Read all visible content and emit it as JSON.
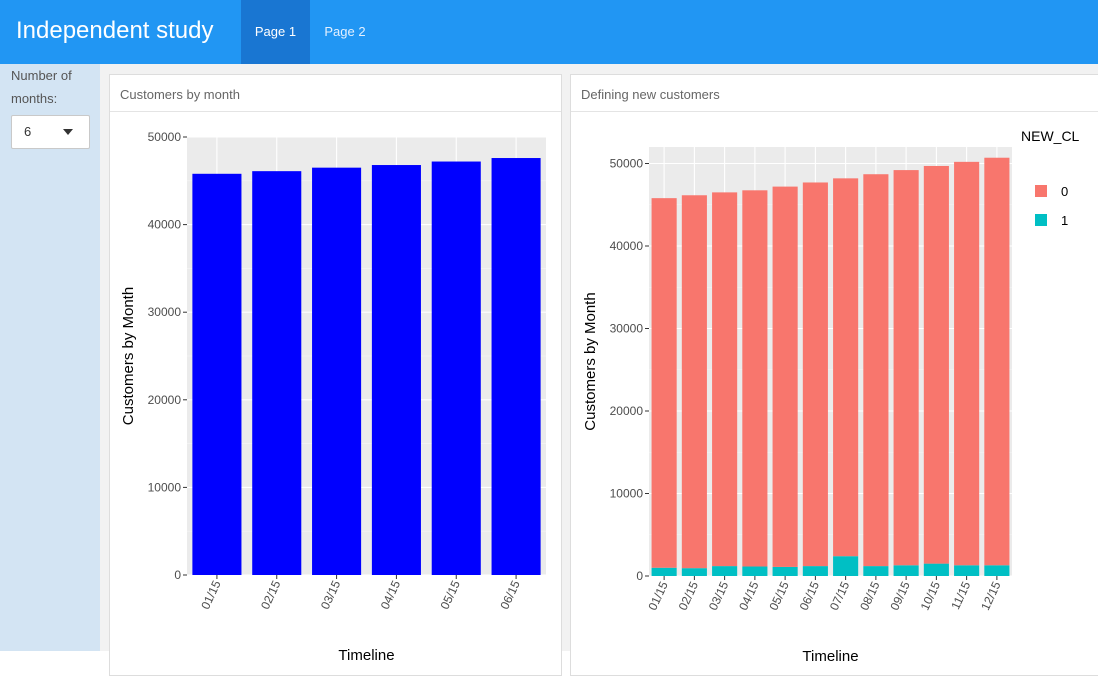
{
  "app": {
    "title": "Independent study",
    "tabs": [
      {
        "label": "Page 1",
        "active": true
      },
      {
        "label": "Page 2",
        "active": false
      }
    ]
  },
  "sidebar": {
    "months_label": "Number of months:",
    "months_value": "6"
  },
  "colors": {
    "navbar": "#2196f3",
    "active_tab": "#1976d2",
    "sidebar": "#d3e4f3",
    "bar_blue": "#0000ff",
    "series_0": "#f8766d",
    "series_1": "#00bfc4",
    "panel": "#ebebeb"
  },
  "panels": [
    {
      "title": "Customers by month"
    },
    {
      "title": "Defining new customers"
    }
  ],
  "chart_data": [
    {
      "type": "bar",
      "categories": [
        "01/15",
        "02/15",
        "03/15",
        "04/15",
        "05/15",
        "06/15"
      ],
      "values": [
        45800,
        46100,
        46500,
        46800,
        47200,
        47600
      ],
      "ylim": [
        0,
        50000
      ],
      "yticks": [
        "0",
        "10000",
        "20000",
        "30000",
        "40000",
        "50000"
      ],
      "xlabel": "Timeline",
      "ylabel": "Customers by Month",
      "grid": true
    },
    {
      "type": "bar",
      "stacked": true,
      "categories": [
        "01/15",
        "02/15",
        "03/15",
        "04/15",
        "05/15",
        "06/15",
        "07/15",
        "08/15",
        "09/15",
        "10/15",
        "11/15",
        "12/15"
      ],
      "series": [
        {
          "name": "0",
          "values": [
            44800,
            45200,
            45300,
            45600,
            46100,
            46500,
            45800,
            47500,
            47900,
            48200,
            48900,
            49400
          ]
        },
        {
          "name": "1",
          "values": [
            1000,
            950,
            1200,
            1150,
            1100,
            1200,
            2400,
            1200,
            1300,
            1500,
            1300,
            1300
          ]
        }
      ],
      "ylim": [
        0,
        52000
      ],
      "yticks": [
        "0",
        "10000",
        "20000",
        "30000",
        "40000",
        "50000"
      ],
      "xlabel": "Timeline",
      "ylabel": "Customers by Month",
      "legend_title": "NEW_CL",
      "legend_position": "right",
      "grid": true
    }
  ]
}
